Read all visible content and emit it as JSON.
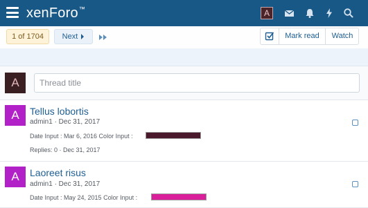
{
  "header": {
    "logo": "xenForo",
    "logo_tm": "™",
    "avatar_letter": "A",
    "icons": [
      "menu-icon",
      "inbox-icon",
      "bell-icon",
      "bolt-icon",
      "search-icon"
    ],
    "brand_color": "#185886"
  },
  "toolbar": {
    "page_indicator": "1 of 1704",
    "next_label": "Next",
    "mark_read_label": "Mark read",
    "watch_label": "Watch"
  },
  "new_thread": {
    "avatar_letter": "A",
    "title_placeholder": "Thread title"
  },
  "threads": [
    {
      "avatar_letter": "A",
      "title": "Tellus lobortis",
      "meta": "admin1 · Dec 31, 2017",
      "fields": "Date Input : Mar 6, 2016 Color Input :",
      "color": "#4a1a2c",
      "replies": "Replies: 0 · Dec 31, 2017"
    },
    {
      "avatar_letter": "A",
      "title": "Laoreet risus",
      "meta": "admin1 · Dec 31, 2017",
      "fields": "Date Input : May 24, 2015 Color Input :",
      "color": "#d9209a"
    }
  ]
}
